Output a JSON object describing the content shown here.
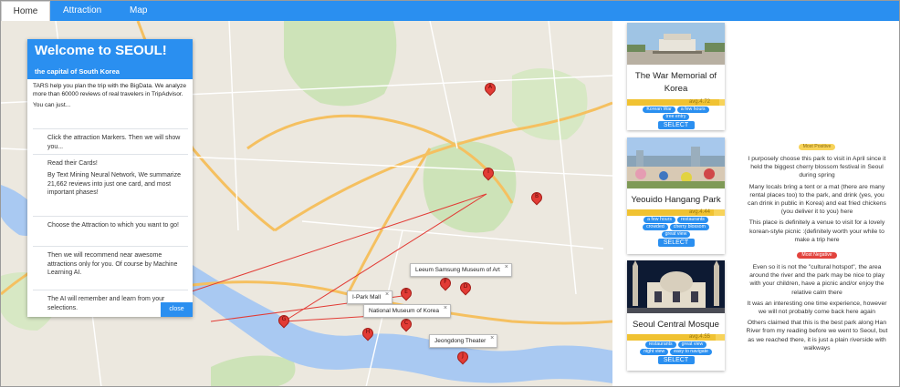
{
  "nav": {
    "tabs": [
      {
        "label": "Home",
        "active": true
      },
      {
        "label": "Attraction",
        "active": false
      },
      {
        "label": "Map",
        "active": false
      }
    ]
  },
  "colors": {
    "accent": "#2a8ff0",
    "marker": "#e23b35",
    "positive": "#f7d35a",
    "negative": "#e2433d"
  },
  "welcome": {
    "title": "Welcome to SEOUL!",
    "subtitle": "the capital of South Korea",
    "intro": "TARS help you plan the trip with the BigData. We analyze more than 60000 reviews of real travelers in TripAdvisor.",
    "intro2": "You can just...",
    "steps": [
      "Click the attraction Markers. Then we will show you...",
      "Read their Cards!",
      "By Text Mining Neural Network, We summarize 21,662 reviews into just one card, and most important phases!",
      "Choose the Attraction to which you want to go!",
      "Then we will recommend near awesome attractions only for you. Of course by Machine Learning AI.",
      "The AI will remember and learn from your selections."
    ],
    "close_label": "close"
  },
  "map": {
    "markers": [
      "A",
      "I",
      "B",
      "F",
      "D",
      "E",
      "G",
      "H",
      "C",
      "J"
    ],
    "infowindows": [
      {
        "label": "Leeum Samsung Museum of Art"
      },
      {
        "label": "I-Park Mall"
      },
      {
        "label": "National Museum of Korea"
      },
      {
        "label": "Jeongdong Theater"
      }
    ]
  },
  "cards": [
    {
      "title": "The War Memorial of Korea",
      "avg": "avg.4.72",
      "rating": 0.944,
      "tags": [
        "Korean War",
        "a few hours",
        "tree entry"
      ],
      "select": "SELECT"
    },
    {
      "title": "Yeouido Hangang Park",
      "avg": "avg.4.44",
      "rating": 0.888,
      "tags": [
        "a few hours",
        "restaurants",
        "crowded",
        "cherry blossom",
        "great view"
      ],
      "select": "SELECT"
    },
    {
      "title": "Seoul Central Mosque",
      "avg": "avg.4.55",
      "rating": 0.91,
      "tags": [
        "restaurants",
        "great view",
        "night view",
        "easy to navigate"
      ],
      "select": "SELECT"
    }
  ],
  "review": {
    "positive_label": "Most Positive",
    "positive": [
      "I purposely choose this park to visit in April since it held the biggest cherry blossom festival in Seoul during spring",
      "Many locals bring a tent or a mat (there are many rental places too) to the park, and drink (yes, you can drink in public in Korea) and eat fried chickens (you deliver it to you) here",
      "This place is definitely a venue to visit for a lovely korean-style picnic :(definitely worth your while to make a trip here"
    ],
    "negative_label": "Most Negative",
    "negative": [
      "Even so it is not the \"cultural hotspot\", the area around the river and the park may be nice to play with your children, have a picnic and/or enjoy the relative calm there",
      "It was an interesting one time experience, however we will not probably come back here again",
      "Others claimed that this is the best park along Han River from my reading before we went to Seoul, but as we reached there, it is just a plain riverside with walkways"
    ]
  }
}
